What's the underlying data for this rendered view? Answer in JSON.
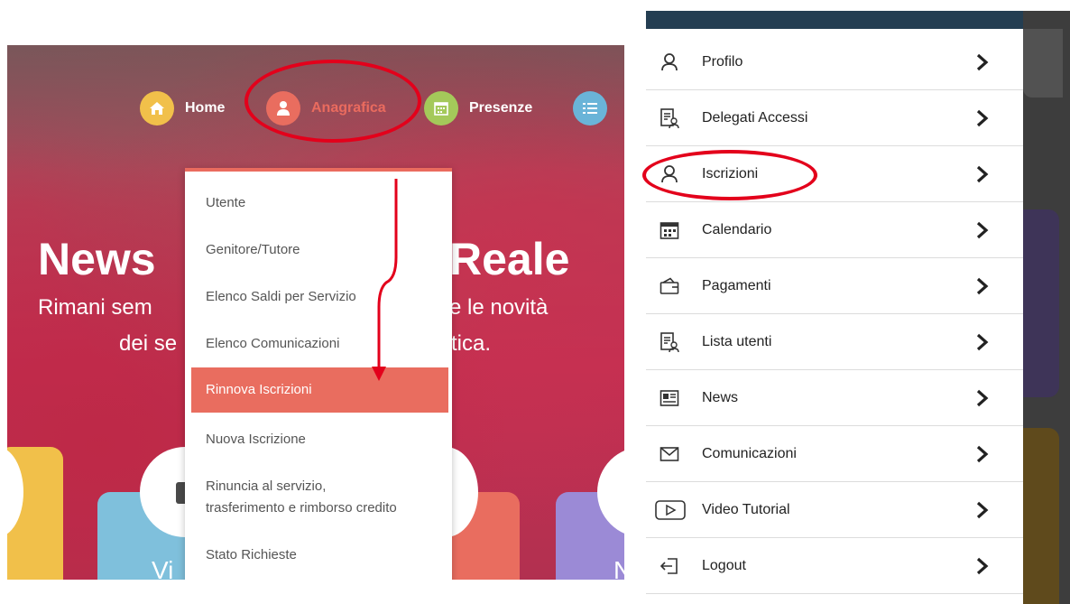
{
  "left_nav": {
    "items": [
      {
        "label": "Home",
        "icon": "home-icon",
        "color": "#f1c04a"
      },
      {
        "label": "Anagrafica",
        "icon": "user-icon",
        "color": "#e96d5f"
      },
      {
        "label": "Presenze",
        "icon": "calendar-icon",
        "color": "#a4c95a"
      },
      {
        "label": "",
        "icon": "list-icon",
        "color": "#6ab4d8"
      }
    ]
  },
  "hero": {
    "title_left": "News",
    "title_right": "Reale",
    "sub1_left": "Rimani sem",
    "sub1_right": "e le novità",
    "sub2_left": "dei se",
    "sub2_right": "tica."
  },
  "tiles": {
    "label_left": "Vi",
    "label_right": "N"
  },
  "dropdown": {
    "items": [
      "Utente",
      "Genitore/Tutore",
      "Elenco Saldi per Servizio",
      "Elenco Comunicazioni",
      "Rinnova Iscrizioni",
      "Nuova Iscrizione",
      "Rinuncia al servizio,",
      "trasferimento e rimborso credito",
      "Stato Richieste"
    ],
    "active": "Rinnova Iscrizioni"
  },
  "mobile_menu": {
    "items": [
      {
        "label": "Profilo",
        "icon": "user-icon"
      },
      {
        "label": "Delegati Accessi",
        "icon": "document-user-icon"
      },
      {
        "label": "Iscrizioni",
        "icon": "user-icon"
      },
      {
        "label": "Calendario",
        "icon": "calendar-icon"
      },
      {
        "label": "Pagamenti",
        "icon": "wallet-icon"
      },
      {
        "label": "Lista utenti",
        "icon": "document-user-icon"
      },
      {
        "label": "News",
        "icon": "newspaper-icon"
      },
      {
        "label": "Comunicazioni",
        "icon": "envelope-icon"
      },
      {
        "label": "Video Tutorial",
        "icon": "play-icon"
      },
      {
        "label": "Logout",
        "icon": "logout-icon"
      }
    ]
  },
  "colors": {
    "accent": "#e96d5f",
    "annotation": "#e3001b",
    "menu_header": "#243e52"
  }
}
